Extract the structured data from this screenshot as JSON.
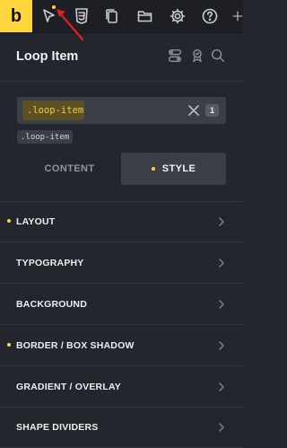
{
  "toolbar": {
    "logo": "b",
    "icons": [
      "cursor-icon",
      "css3-icon",
      "copy-icon",
      "folder-icon",
      "gear-icon",
      "help-icon",
      "plus-icon"
    ],
    "accent": "#ffd53e"
  },
  "header": {
    "title": "Loop Item",
    "icons": [
      "toggle-icon",
      "badge-icon",
      "search-icon"
    ]
  },
  "selector": {
    "class_chip": ".loop-item",
    "count": "1",
    "tag": ".loop-item"
  },
  "tabs": [
    {
      "label": "CONTENT",
      "active": false
    },
    {
      "label": "STYLE",
      "active": true
    }
  ],
  "sections": [
    {
      "label": "LAYOUT",
      "modified": true
    },
    {
      "label": "TYPOGRAPHY",
      "modified": false
    },
    {
      "label": "BACKGROUND",
      "modified": false
    },
    {
      "label": "BORDER / BOX SHADOW",
      "modified": true
    },
    {
      "label": "GRADIENT / OVERLAY",
      "modified": false
    },
    {
      "label": "SHAPE DIVIDERS",
      "modified": false
    }
  ]
}
